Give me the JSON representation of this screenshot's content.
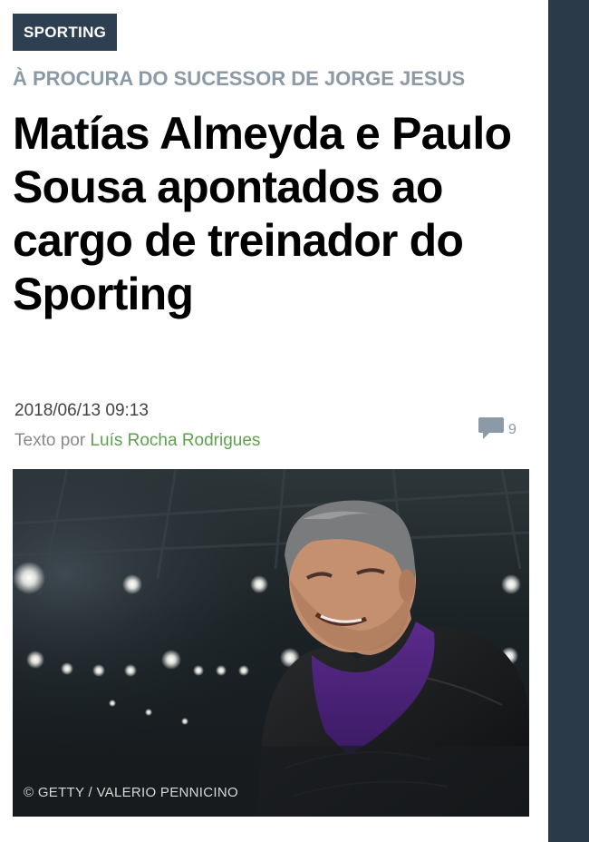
{
  "section": {
    "tag": "SPORTING"
  },
  "article": {
    "kicker": "À PROCURA DO SUCESSOR DE JORGE JESUS",
    "headline": "Matías Almeyda e Paulo Sousa apontados ao cargo de treinador do Sporting",
    "date": "2018/06/13 09:13",
    "byline_prefix": "Texto por",
    "author": "Luís Rocha Rodrigues",
    "comment_count": "9"
  },
  "photo": {
    "credit": "© GETTY / VALERIO PENNICINO"
  },
  "colors": {
    "tag_bg": "#2e3f51",
    "kicker": "#8c99a6",
    "author": "#5fa04e",
    "right_bar": "#2b3a48"
  },
  "icons": {
    "comments": "speech-bubble-icon"
  }
}
